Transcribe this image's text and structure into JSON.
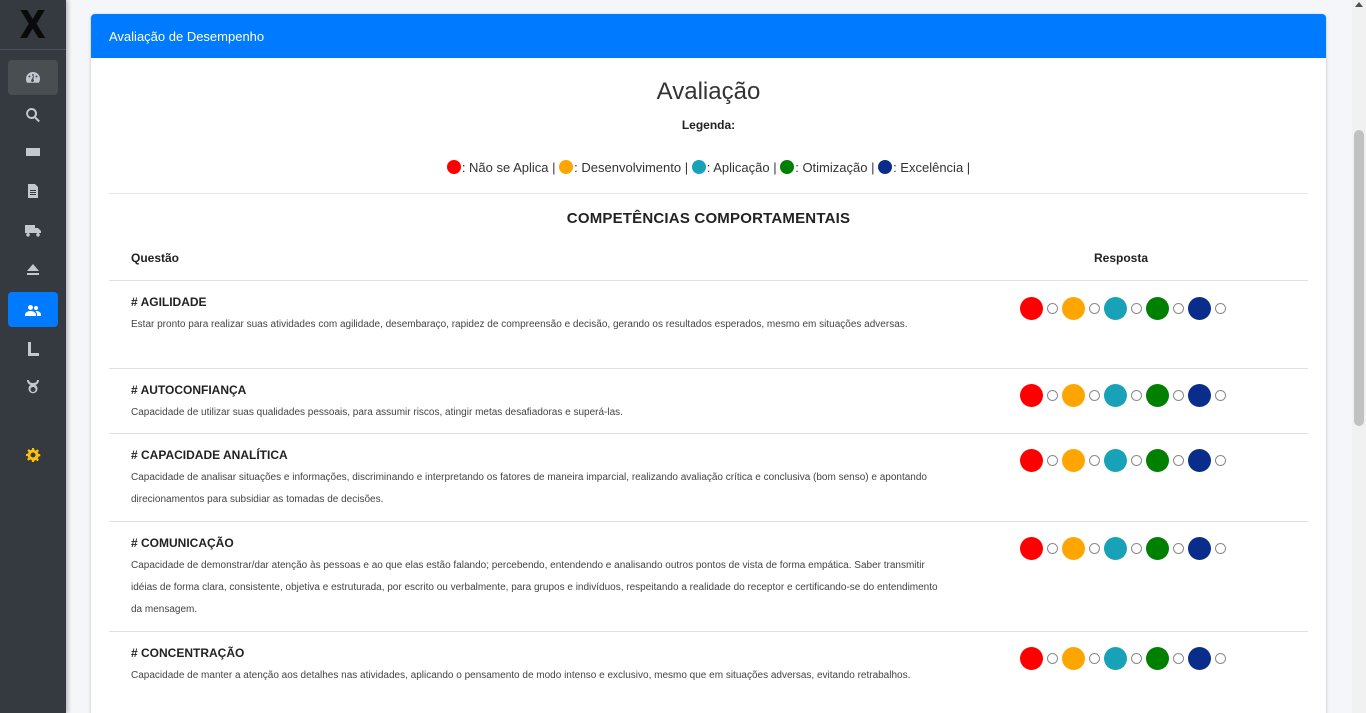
{
  "colors": {
    "nao_se_aplica": "#ff0000",
    "desenvolvimento": "#ffa500",
    "aplicacao": "#17a2b8",
    "otimizacao": "#008000",
    "excelencia": "#0a2d8c",
    "primary": "#007bff"
  },
  "sidebar": {
    "brand": "X",
    "items": [
      {
        "icon": "dashboard-gauge-icon"
      },
      {
        "icon": "search-icon"
      },
      {
        "icon": "id-card-icon"
      },
      {
        "icon": "file-icon"
      },
      {
        "icon": "truck-icon"
      },
      {
        "icon": "eject-icon"
      },
      {
        "icon": "users-icon"
      },
      {
        "icon": "level-icon"
      },
      {
        "icon": "horns-icon"
      },
      {
        "icon": "gear-icon"
      }
    ]
  },
  "card": {
    "header": "Avaliação de Desempenho",
    "title": "Avaliação",
    "legend_title": "Legenda:",
    "legend": [
      {
        "label": ": Não se Aplica |",
        "color": "#ff0000"
      },
      {
        "label": ": Desenvolvimento |",
        "color": "#ffa500"
      },
      {
        "label": ": Aplicação |",
        "color": "#17a2b8"
      },
      {
        "label": ": Otimização |",
        "color": "#008000"
      },
      {
        "label": ": Excelência |",
        "color": "#0a2d8c"
      }
    ],
    "section_title": "COMPETÊNCIAS COMPORTAMENTAIS",
    "col_question": "Questão",
    "col_answer": "Resposta",
    "questions": [
      {
        "title": "# AGILIDADE",
        "description": "Estar pronto para realizar suas atividades com agilidade, desembaraço, rapidez de compreensão e decisão, gerando os resultados esperados, mesmo em situações adversas."
      },
      {
        "title": "# AUTOCONFIANÇA",
        "description": "Capacidade de utilizar suas qualidades pessoais, para assumir riscos, atingir metas desafiadoras e superá-las."
      },
      {
        "title": "# CAPACIDADE ANALÍTICA",
        "description": "Capacidade de analisar situações e informações, discriminando e interpretando os fatores de maneira imparcial, realizando avaliação crítica e conclusiva (bom senso) e apontando direcionamentos para subsidiar as tomadas de decisões."
      },
      {
        "title": "# COMUNICAÇÃO",
        "description": "Capacidade de demonstrar/dar atenção às pessoas e ao que elas estão falando; percebendo, entendendo e analisando outros pontos de vista de forma empática. Saber transmitir idéias de forma clara, consistente, objetiva e estruturada, por escrito ou verbalmente, para grupos e indivíduos, respeitando a realidade do receptor e certificando-se do entendimento da mensagem."
      },
      {
        "title": "# CONCENTRAÇÃO",
        "description": "Capacidade de manter a atenção aos detalhes nas atividades, aplicando o pensamento de modo intenso e exclusivo, mesmo que em situações adversas, evitando retrabalhos."
      }
    ]
  }
}
